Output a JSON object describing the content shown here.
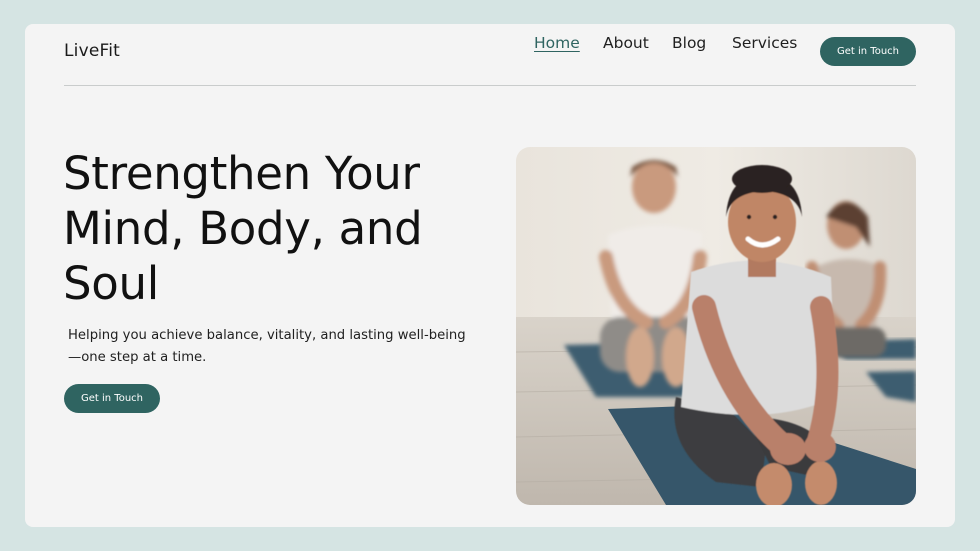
{
  "brand": {
    "logo": "LiveFit"
  },
  "nav": {
    "items": [
      {
        "label": "Home",
        "active": true
      },
      {
        "label": "About",
        "active": false
      },
      {
        "label": "Blog",
        "active": false
      },
      {
        "label": "Services",
        "active": false
      }
    ],
    "cta_label": "Get in Touch"
  },
  "hero": {
    "title": "Strengthen Your Mind, Body, and Soul",
    "subtitle": "Helping you achieve balance, vitality, and lasting well-being—one step at a time.",
    "cta_label": "Get in Touch",
    "image": "smiling-woman-stretching-on-yoga-mat-photo"
  },
  "colors": {
    "page_bg": "#d5e4e3",
    "card_bg": "#f4f4f4",
    "accent": "#2f6461",
    "mat": "#3a5a6e"
  }
}
